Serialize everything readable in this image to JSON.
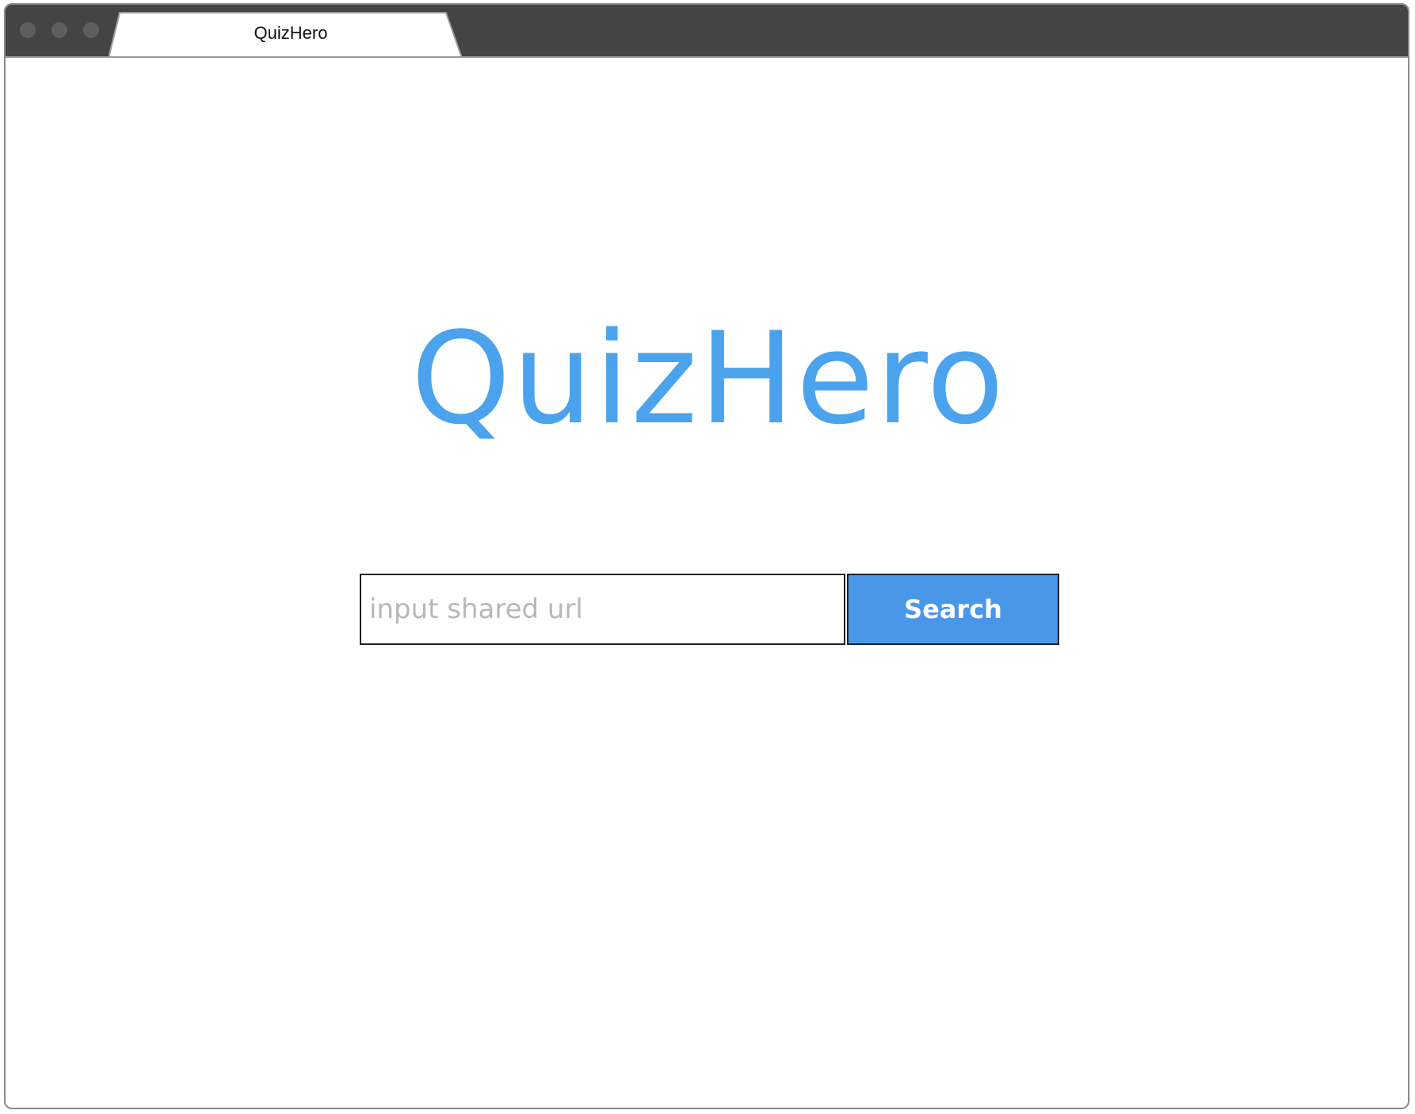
{
  "window": {
    "tab_title": "QuizHero"
  },
  "main": {
    "logo_text": "QuizHero",
    "search": {
      "input_value": "",
      "placeholder": "input shared url",
      "button_label": "Search"
    }
  },
  "colors": {
    "accent": "#4aa3ec",
    "button_bg": "#4a97ea",
    "titlebar_bg": "#444444"
  }
}
